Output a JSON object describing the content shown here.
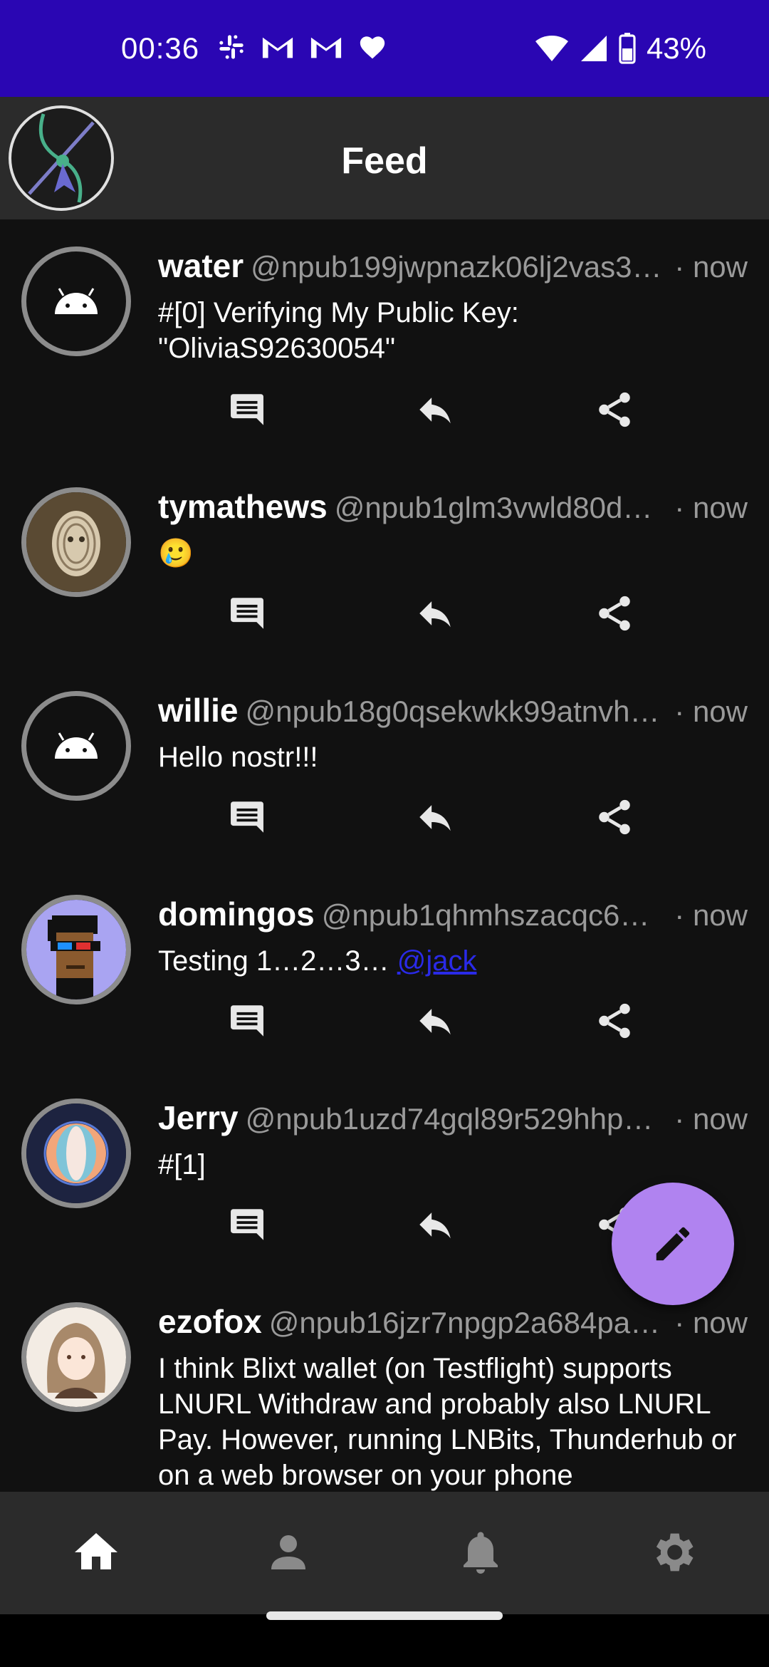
{
  "status_bar": {
    "time": "00:36",
    "notification_icons": [
      "slack-icon",
      "gmail-icon",
      "gmail-icon",
      "heart-icon"
    ],
    "battery": "43%"
  },
  "app_bar": {
    "title": "Feed"
  },
  "posts": [
    {
      "name": "water",
      "handle": "@npub199jwpnazk06lj2vas3…",
      "time": "· now",
      "content": "#[0] Verifying My Public Key: \"OliviaS92630054\""
    },
    {
      "name": "tymathews",
      "handle": "@npub1glm3vwld80dc…",
      "time": "· now",
      "content": "🥲"
    },
    {
      "name": "willie",
      "handle": "@npub18g0qsekwkk99atnvhx…",
      "time": "· now",
      "content": "Hello nostr!!!"
    },
    {
      "name": "domingos",
      "handle": "@npub1qhmhszacqc6k…",
      "time": "· now",
      "content": "Testing 1…2…3…",
      "mention": "@jack"
    },
    {
      "name": "Jerry",
      "handle": "@npub1uzd74gql89r529hhpy…",
      "time": "· now",
      "content": "#[1]"
    },
    {
      "name": "ezofox",
      "handle": "@npub16jzr7npgp2a684pas…",
      "time": "· now",
      "content": "I think Blixt wallet (on Testflight) supports LNURL Withdraw and probably also LNURL Pay. However, running LNBits, Thunderhub or  on a web browser on your phone"
    }
  ],
  "colors": {
    "status_bar": "#2a06b3",
    "app_bar": "#2b2b2b",
    "background": "#111111",
    "fab": "#b083f0",
    "link": "#2a2ae8"
  },
  "bottom_nav": [
    "home-icon",
    "profile-icon",
    "notifications-icon",
    "settings-icon"
  ]
}
